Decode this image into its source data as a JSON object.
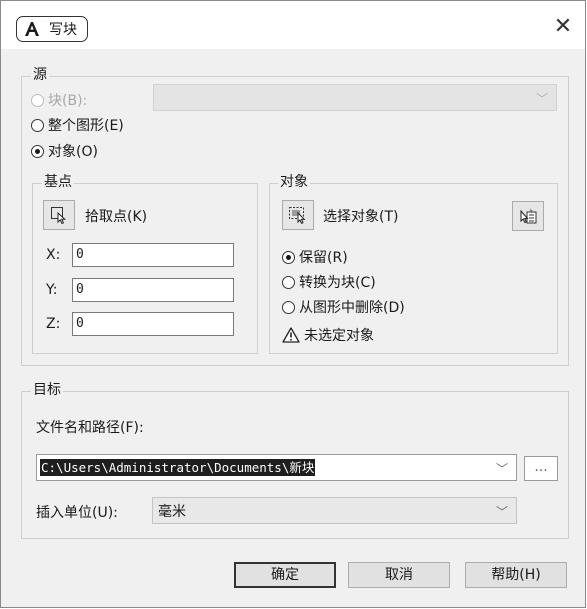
{
  "window": {
    "title": "写块",
    "close_glyph": "✕"
  },
  "source": {
    "label": "源",
    "block_option": "块(B):",
    "whole_drawing_option": "整个图形(E)",
    "objects_option": "对象(O)",
    "selected": "objects"
  },
  "base_point": {
    "label": "基点",
    "pick_point_label": "拾取点(K)",
    "x_label": "X:",
    "x_value": "0",
    "y_label": "Y:",
    "y_value": "0",
    "z_label": "Z:",
    "z_value": "0"
  },
  "objects": {
    "label": "对象",
    "select_objects_label": "选择对象(T)",
    "retain_option": "保留(R)",
    "convert_option": "转换为块(C)",
    "delete_option": "从图形中删除(D)",
    "selected": "retain",
    "warning_text": "未选定对象"
  },
  "destination": {
    "label": "目标",
    "file_path_label": "文件名和路径(F):",
    "file_path_value": "C:\\Users\\Administrator\\Documents\\新块",
    "browse_label": "...",
    "insert_units_label": "插入单位(U):",
    "insert_units_value": "毫米"
  },
  "buttons": {
    "ok": "确定",
    "cancel": "取消",
    "help": "帮助(H)"
  },
  "icons": {
    "logo": "autocad-a-icon",
    "pick_point": "pick-point-icon",
    "select_objects": "select-objects-icon",
    "quick_select": "quick-select-icon",
    "warning": "warning-icon"
  }
}
